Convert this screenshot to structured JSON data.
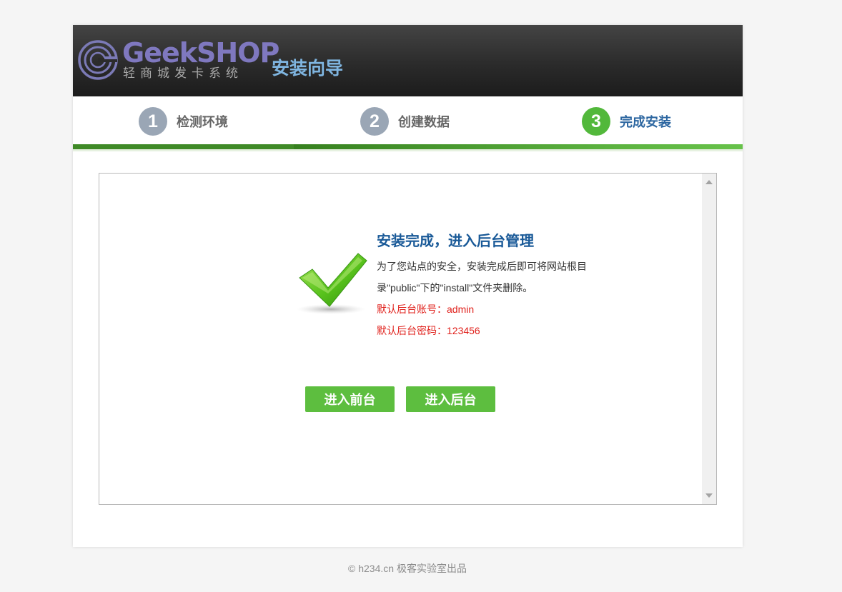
{
  "header": {
    "logo_text": "GeekSHOP",
    "logo_subtitle": "轻商城发卡系统",
    "wizard_title": "安装向导"
  },
  "steps": [
    {
      "number": "1",
      "label": "检测环境",
      "active": false
    },
    {
      "number": "2",
      "label": "创建数据",
      "active": false
    },
    {
      "number": "3",
      "label": "完成安装",
      "active": true
    }
  ],
  "result": {
    "title": "安装完成，进入后台管理",
    "line1": "为了您站点的安全，安装完成后即可将网站根目",
    "line2": "录\"public\"下的\"install\"文件夹删除。",
    "account": "默认后台账号：admin",
    "password": "默认后台密码：123456"
  },
  "buttons": {
    "front": "进入前台",
    "admin": "进入后台"
  },
  "footer": "© h234.cn 极客实验室出品",
  "colors": {
    "accent_green": "#5dbe3f",
    "title_blue": "#1a5a98",
    "warning_red": "#e0201b",
    "step_inactive": "#9aa6b5"
  },
  "icons": {
    "success": "checkmark-icon",
    "logo": "logo-mark-icon"
  }
}
